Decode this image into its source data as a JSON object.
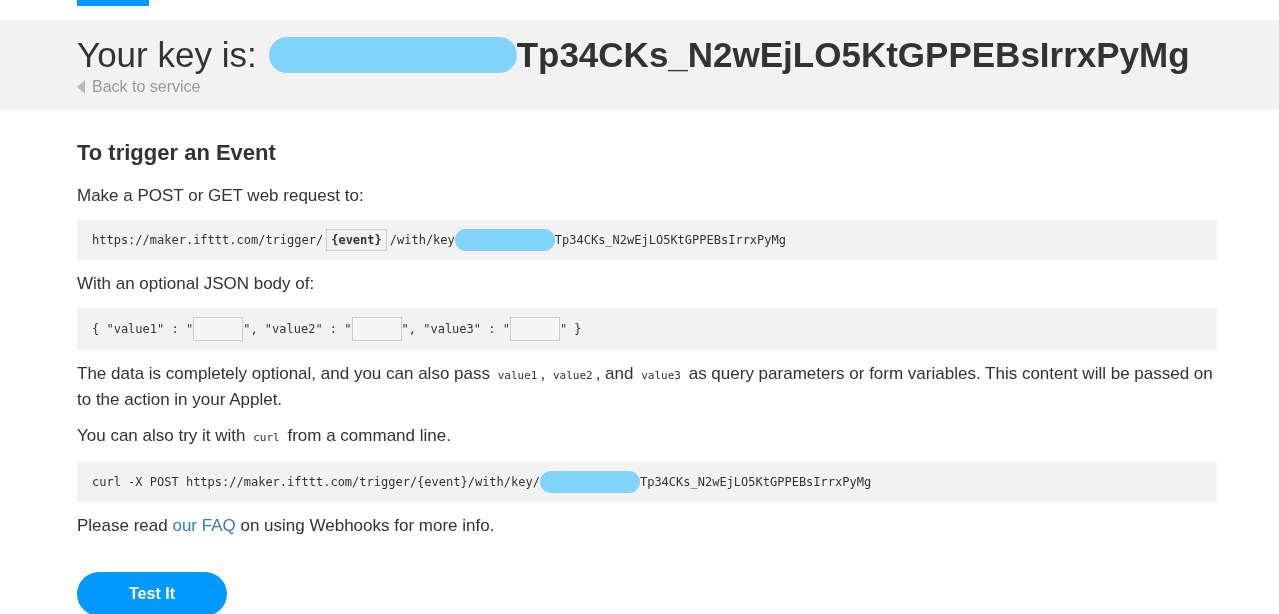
{
  "header": {
    "title_label": "Your key is:",
    "key_redacted": true,
    "key_visible": "Tp34CKs_N2wEjLO5KtGPPEBsIrrxPyMg",
    "back_link": "Back to service"
  },
  "heading": "To trigger an Event",
  "blocks": [
    {
      "kind": "para",
      "segments": [
        {
          "kind": "text",
          "text": "Make a POST or GET web request to:"
        }
      ]
    },
    {
      "kind": "code",
      "segments": [
        {
          "kind": "text",
          "text": "https://maker.ifttt.com/trigger/"
        },
        {
          "kind": "field",
          "text": "{event}"
        },
        {
          "kind": "text",
          "text": "/with/key"
        },
        {
          "kind": "redacted"
        },
        {
          "kind": "text",
          "text": "Tp34CKs_N2wEjLO5KtGPPEBsIrrxPyMg"
        }
      ]
    },
    {
      "kind": "para",
      "segments": [
        {
          "kind": "text",
          "text": "With an optional JSON body of:"
        }
      ]
    },
    {
      "kind": "code",
      "segments": [
        {
          "kind": "text",
          "text": "{ \"value1\" : \""
        },
        {
          "kind": "input"
        },
        {
          "kind": "text",
          "text": "\", \"value2\" : \""
        },
        {
          "kind": "input"
        },
        {
          "kind": "text",
          "text": "\", \"value3\" : \""
        },
        {
          "kind": "input"
        },
        {
          "kind": "text",
          "text": "\" }"
        }
      ]
    },
    {
      "kind": "para",
      "segments": [
        {
          "kind": "text",
          "text": "The data is completely optional, and you can also pass "
        },
        {
          "kind": "code",
          "text": "value1"
        },
        {
          "kind": "text",
          "text": ", "
        },
        {
          "kind": "code",
          "text": "value2"
        },
        {
          "kind": "text",
          "text": ", and "
        },
        {
          "kind": "code",
          "text": "value3"
        },
        {
          "kind": "text",
          "text": " as query parameters or form variables. This content will be passed on to the action in your Applet."
        }
      ]
    },
    {
      "kind": "para",
      "segments": [
        {
          "kind": "text",
          "text": "You can also try it with "
        },
        {
          "kind": "code",
          "text": "curl"
        },
        {
          "kind": "text",
          "text": " from a command line."
        }
      ]
    },
    {
      "kind": "code",
      "segments": [
        {
          "kind": "text",
          "text": "curl -X POST https://maker.ifttt.com/trigger/{event}/with/key/"
        },
        {
          "kind": "redacted"
        },
        {
          "kind": "text",
          "text": "Tp34CKs_N2wEjLO5KtGPPEBsIrrxPyMg"
        }
      ]
    },
    {
      "kind": "para",
      "segments": [
        {
          "kind": "text",
          "text": "Please read "
        },
        {
          "kind": "link",
          "text": "our FAQ"
        },
        {
          "kind": "text",
          "text": " on using Webhooks for more info."
        }
      ]
    }
  ],
  "button": "Test It"
}
